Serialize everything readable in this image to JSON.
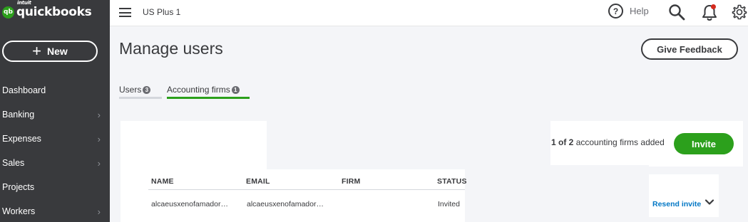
{
  "app": {
    "logo_mark": "qb",
    "logo_brand": "intuit",
    "logo_name": "quickbooks",
    "company_name": "US Plus 1"
  },
  "sidebar": {
    "new_button": {
      "icon": "plus-icon",
      "label": "New"
    },
    "items": [
      {
        "label": "Dashboard",
        "has_submenu": false
      },
      {
        "label": "Banking",
        "has_submenu": true
      },
      {
        "label": "Expenses",
        "has_submenu": true
      },
      {
        "label": "Sales",
        "has_submenu": true
      },
      {
        "label": "Projects",
        "has_submenu": false
      },
      {
        "label": "Workers",
        "has_submenu": true
      }
    ]
  },
  "topbar": {
    "help_label": "Help",
    "help_glyph": "?",
    "icons": [
      "menu-icon",
      "help-icon",
      "search-icon",
      "bell-icon",
      "gear-icon"
    ]
  },
  "page": {
    "title": "Manage users",
    "feedback_button": "Give Feedback",
    "tabs": [
      {
        "label": "Users",
        "count": "3",
        "active": false
      },
      {
        "label": "Accounting firms",
        "count": "1",
        "active": true
      }
    ]
  },
  "firms": {
    "count_bold": "1 of 2",
    "count_rest": "accounting firms added",
    "invite_button": "Invite",
    "columns": [
      "NAME",
      "EMAIL",
      "FIRM",
      "STATUS"
    ],
    "rows": [
      {
        "name": "alcaeusxenofamador…",
        "email": "alcaeusxenofamador…",
        "firm": "",
        "status": "Invited",
        "action": "Resend invite"
      }
    ]
  },
  "colors": {
    "sidebar_bg": "#393a3d",
    "brand_green": "#2ca01c",
    "link_blue": "#0077c5",
    "page_bg": "#f4f5f8",
    "notification_red": "#d52b1e"
  }
}
